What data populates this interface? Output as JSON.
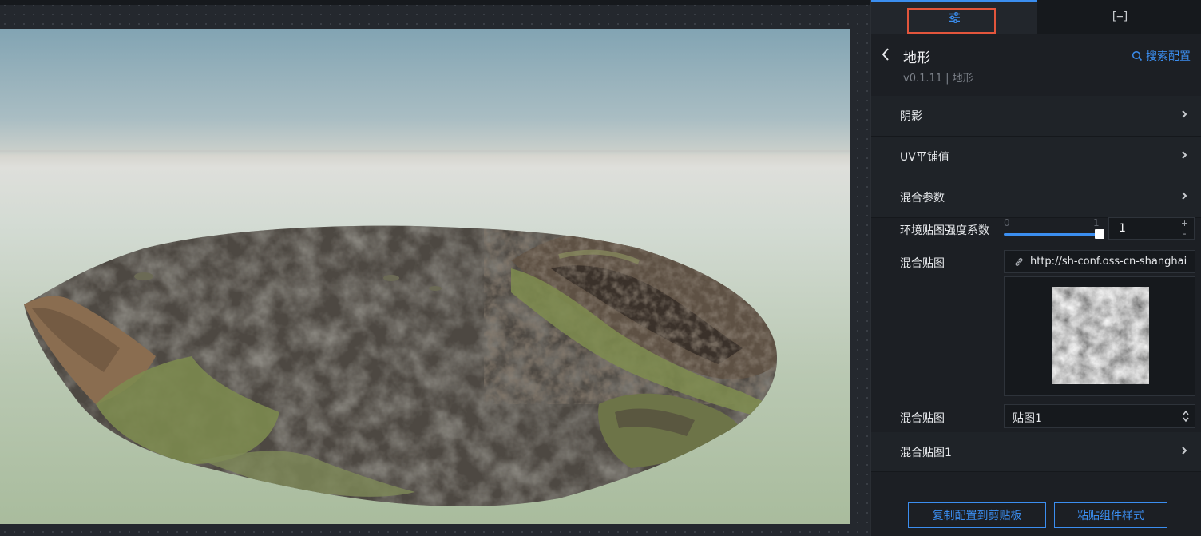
{
  "tabs": {
    "config_icon": "sliders-icon",
    "layers_glyph": "[−]"
  },
  "component": {
    "title": "地形",
    "subtitle": "v0.1.11 | 地形",
    "search_label": "搜索配置"
  },
  "sections": [
    {
      "label": "阴影"
    },
    {
      "label": "UV平铺值"
    },
    {
      "label": "混合参数"
    }
  ],
  "env_strength": {
    "label": "环境贴图强度系数",
    "min": "0",
    "max": "1",
    "value": "1",
    "fill_fraction": 1.0
  },
  "blend_texture": {
    "label": "混合贴图",
    "url": "http://sh-conf.oss-cn-shanghai"
  },
  "blend_select": {
    "label": "混合贴图",
    "value": "贴图1"
  },
  "blend_texture1": {
    "label": "混合贴图1"
  },
  "stepper": {
    "plus": "+",
    "minus": "-"
  },
  "footer": {
    "copy_label": "复制配置到剪贴板",
    "paste_label": "粘贴组件样式"
  },
  "colors": {
    "accent": "#3b8ef0",
    "highlight": "#e2553c"
  }
}
